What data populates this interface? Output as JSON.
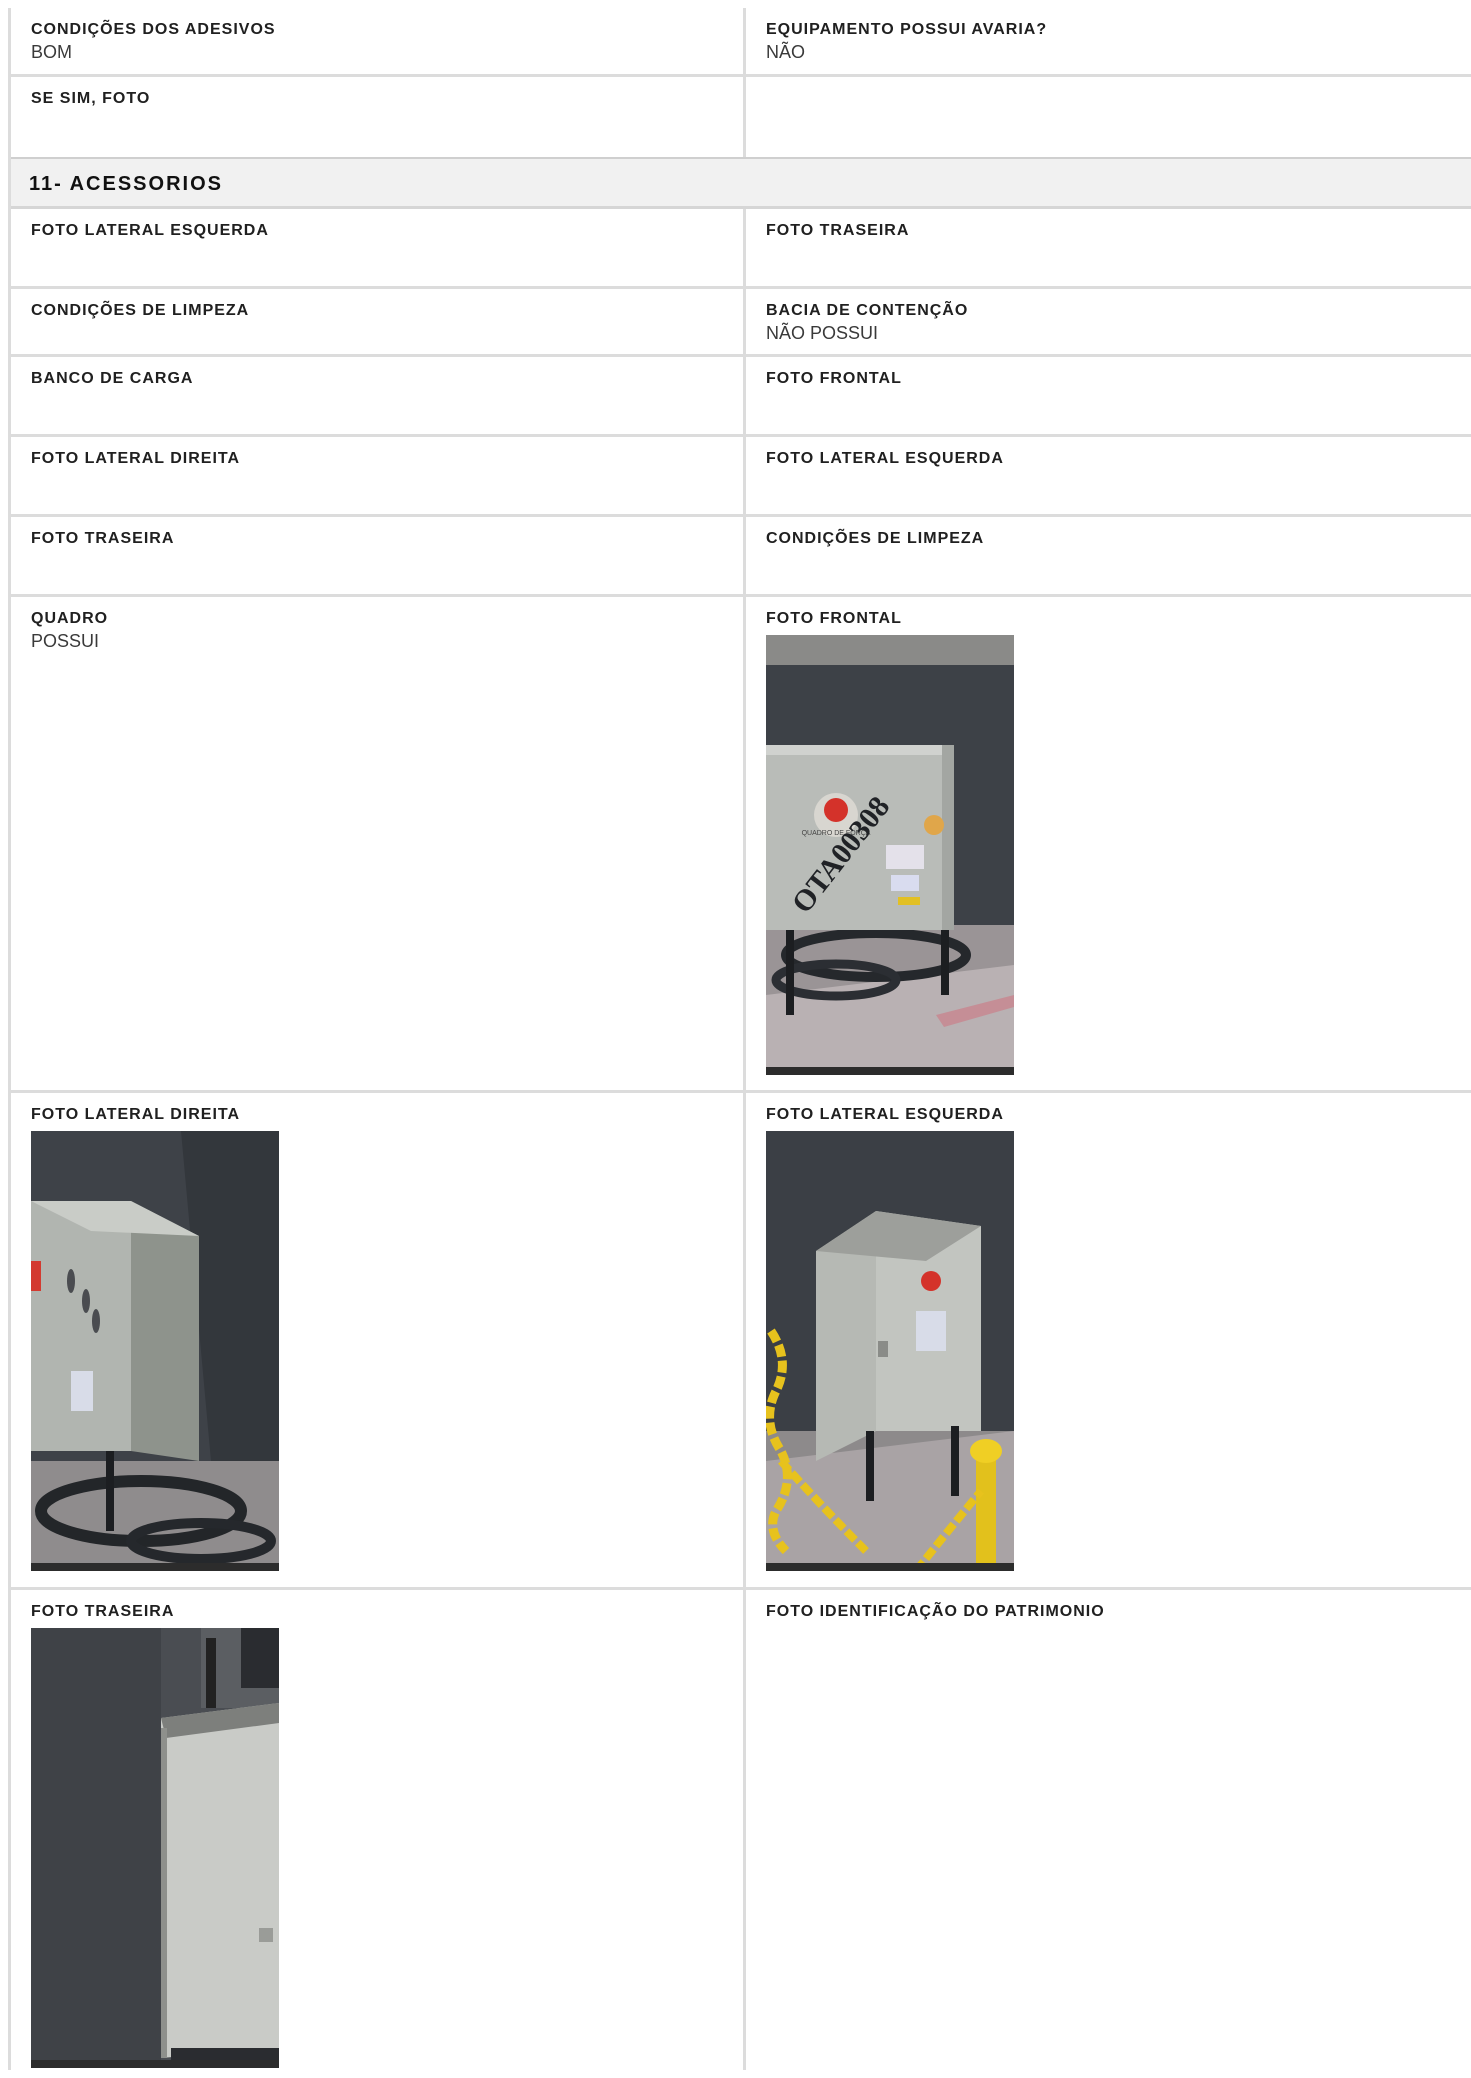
{
  "rows_top": [
    {
      "left": {
        "label": "CONDIÇÕES DOS ADESIVOS",
        "value": "BOM"
      },
      "right": {
        "label": "EQUIPAMENTO POSSUI AVARIA?",
        "value": "NÃO"
      }
    },
    {
      "left": {
        "label": "SE SIM, FOTO",
        "value": ""
      },
      "right": {
        "label": "",
        "value": ""
      }
    }
  ],
  "section": {
    "title": "11- ACESSORIOS"
  },
  "rows": [
    {
      "left": {
        "label": "FOTO LATERAL ESQUERDA",
        "value": ""
      },
      "right": {
        "label": "FOTO TRASEIRA",
        "value": ""
      }
    },
    {
      "left": {
        "label": "CONDIÇÕES DE LIMPEZA",
        "value": ""
      },
      "right": {
        "label": "BACIA DE CONTENÇÃO",
        "value": "NÃO POSSUI"
      }
    },
    {
      "left": {
        "label": "BANCO DE CARGA",
        "value": ""
      },
      "right": {
        "label": "FOTO FRONTAL",
        "value": ""
      }
    },
    {
      "left": {
        "label": "FOTO LATERAL DIREITA",
        "value": ""
      },
      "right": {
        "label": "FOTO LATERAL ESQUERDA",
        "value": ""
      }
    },
    {
      "left": {
        "label": "FOTO TRASEIRA",
        "value": ""
      },
      "right": {
        "label": "CONDIÇÕES DE LIMPEZA",
        "value": ""
      }
    }
  ],
  "photo_rows": [
    {
      "left": {
        "label": "QUADRO",
        "value": "POSSUI"
      },
      "right": {
        "label": "FOTO FRONTAL"
      }
    },
    {
      "left": {
        "label": "FOTO LATERAL DIREITA"
      },
      "right": {
        "label": "FOTO LATERAL ESQUERDA"
      }
    },
    {
      "left": {
        "label": "FOTO TRASEIRA"
      },
      "right": {
        "label": "FOTO IDENTIFICAÇÃO DO PATRIMONIO"
      }
    }
  ],
  "photos": {
    "frontal_box_marking": "OTA00308"
  }
}
